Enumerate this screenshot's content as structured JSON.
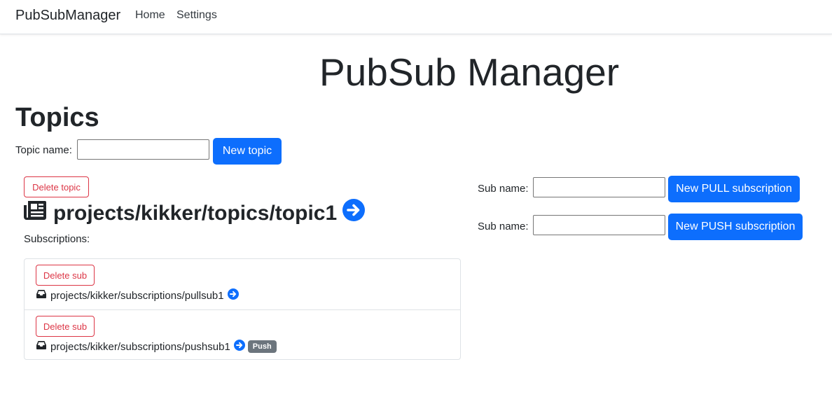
{
  "navbar": {
    "brand": "PubSubManager",
    "links": [
      "Home",
      "Settings"
    ]
  },
  "page": {
    "title": "PubSub Manager",
    "topics_heading": "Topics"
  },
  "new_topic": {
    "label": "Topic name:",
    "value": "",
    "button": "New topic"
  },
  "topic": {
    "delete_label": "Delete topic",
    "name": "projects/kikker/topics/topic1",
    "subscriptions_label": "Subscriptions:",
    "subscriptions": [
      {
        "delete_label": "Delete sub",
        "name": "projects/kikker/subscriptions/pullsub1",
        "badge": ""
      },
      {
        "delete_label": "Delete sub",
        "name": "projects/kikker/subscriptions/pushsub1",
        "badge": "Push"
      }
    ]
  },
  "new_subscription": {
    "pull": {
      "label": "Sub name:",
      "value": "",
      "button": "New PULL subscription"
    },
    "push": {
      "label": "Sub name:",
      "value": "",
      "button": "New PUSH subscription"
    }
  },
  "icons": {
    "topic": "newspaper-icon",
    "subscription": "inbox-icon",
    "open": "arrow-right-circle-icon"
  },
  "colors": {
    "primary": "#0d6efd",
    "danger": "#dc3545",
    "badge": "#6c757d"
  }
}
